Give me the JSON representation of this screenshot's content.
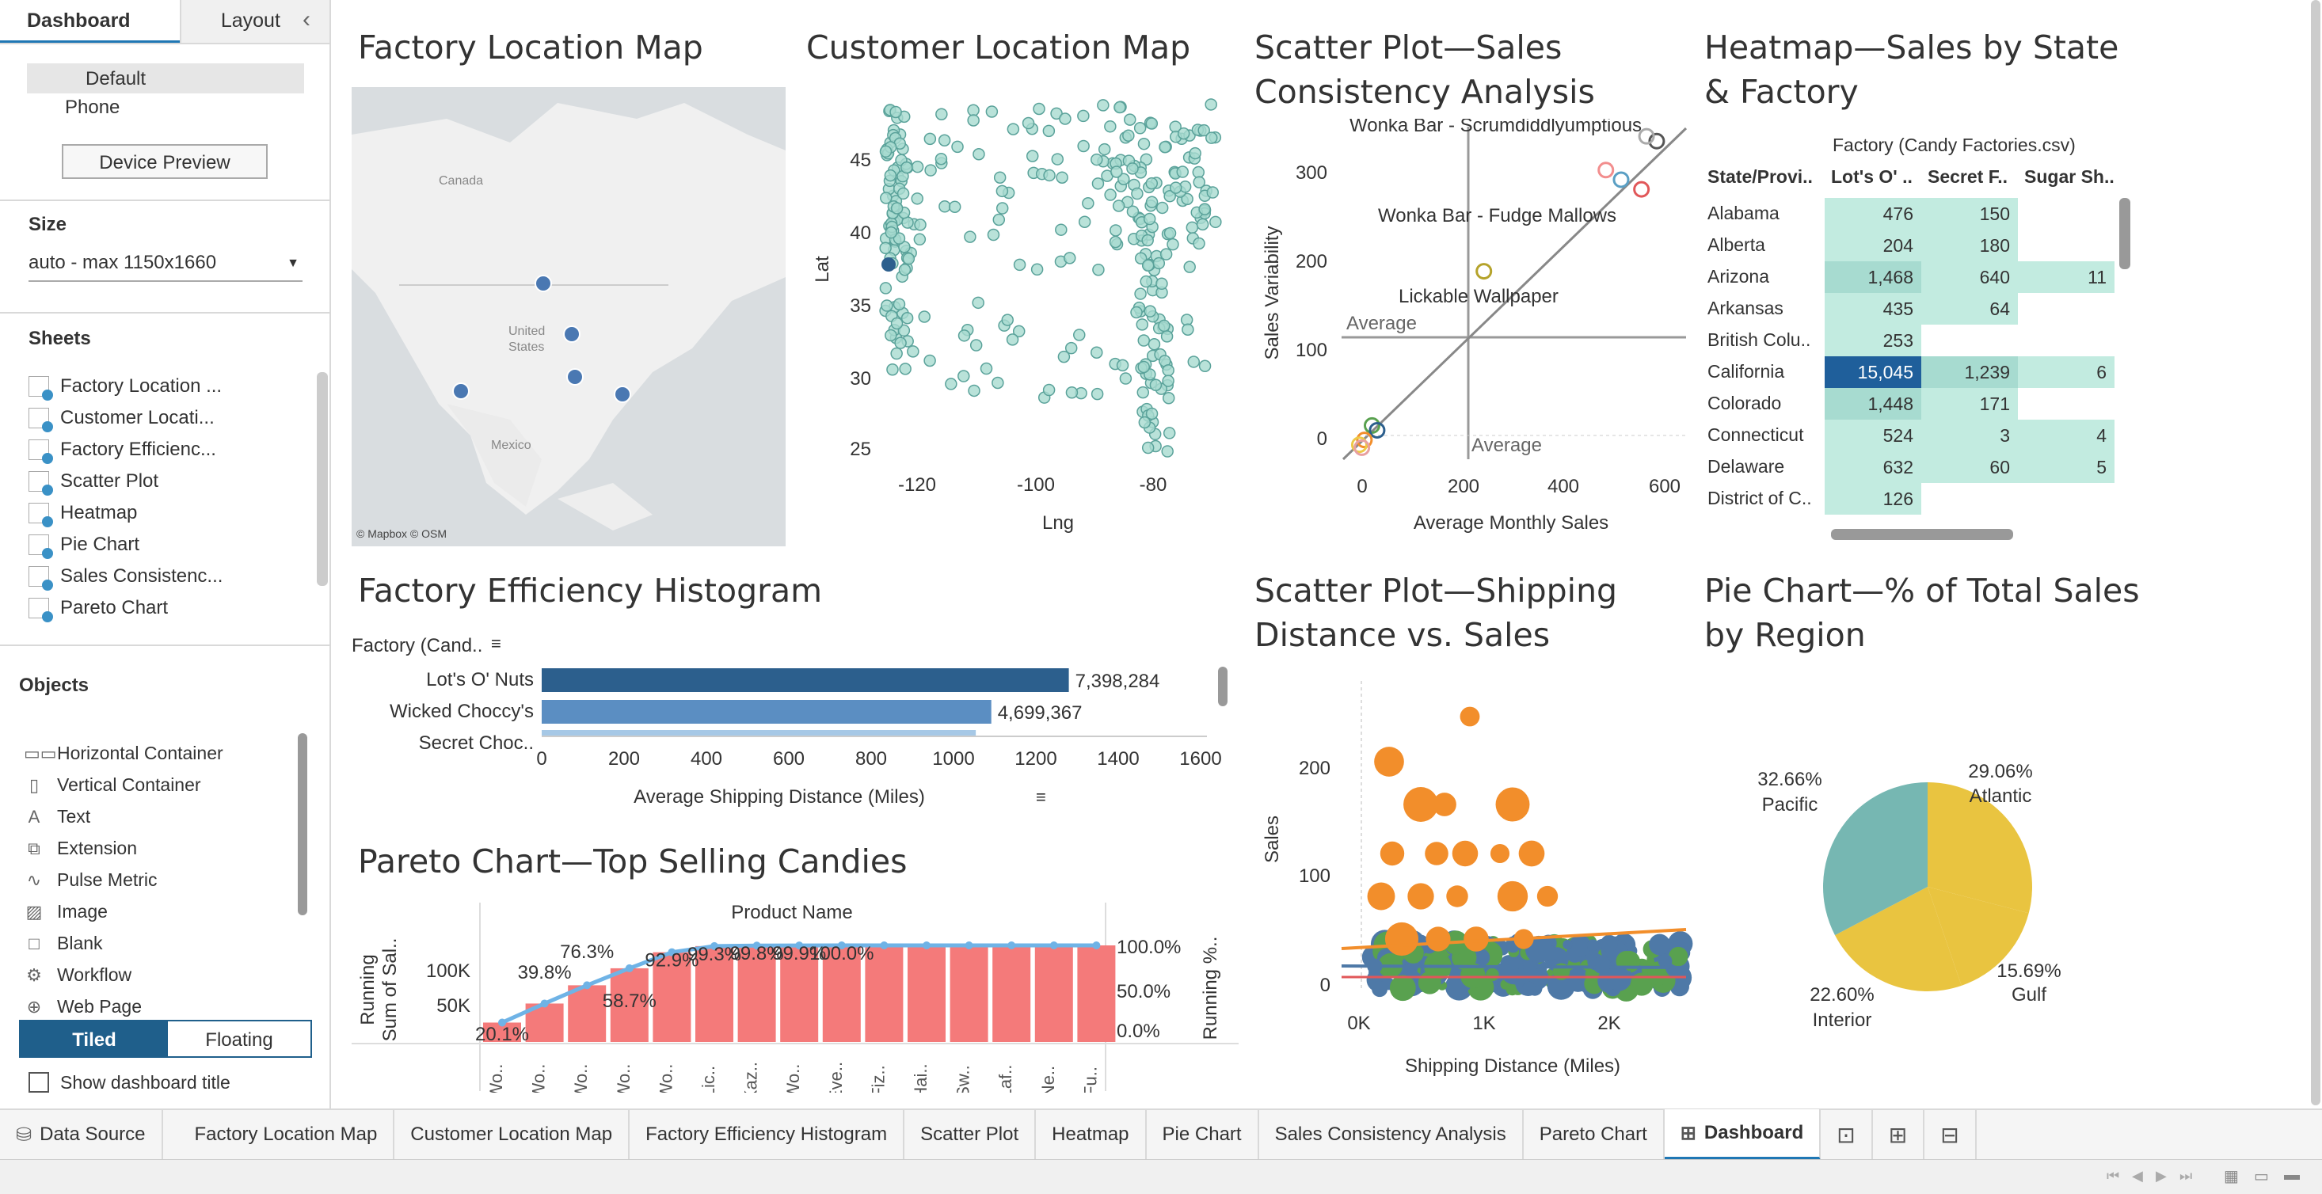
{
  "left_panel": {
    "tab_dashboard": "Dashboard",
    "tab_layout": "Layout",
    "device_default": "Default",
    "device_phone": "Phone",
    "device_preview": "Device Preview",
    "size_label": "Size",
    "size_value": "auto - max 1150x1660",
    "sheets_label": "Sheets",
    "sheets": [
      "Factory Location ...",
      "Customer Locati...",
      "Factory Efficienc...",
      "Scatter Plot",
      "Heatmap",
      "Pie Chart",
      "Sales Consistenc...",
      "Pareto Chart"
    ],
    "objects_label": "Objects",
    "objects": [
      {
        "icon": "horizontal-container-icon",
        "label": "Horizontal Container"
      },
      {
        "icon": "vertical-container-icon",
        "label": "Vertical Container"
      },
      {
        "icon": "text-icon",
        "label": "Text"
      },
      {
        "icon": "extension-icon",
        "label": "Extension"
      },
      {
        "icon": "pulse-metric-icon",
        "label": "Pulse Metric"
      },
      {
        "icon": "image-icon",
        "label": "Image"
      },
      {
        "icon": "blank-icon",
        "label": "Blank"
      },
      {
        "icon": "workflow-icon",
        "label": "Workflow"
      },
      {
        "icon": "web-page-icon",
        "label": "Web Page"
      }
    ],
    "tiled": "Tiled",
    "floating": "Floating",
    "show_title": "Show dashboard title"
  },
  "titles": {
    "factory_map": "Factory Location Map",
    "customer_map": "Customer Location Map",
    "scatter_sales_1": "Scatter Plot—Sales",
    "scatter_sales_2": "Consistency Analysis",
    "heatmap_1": "Heatmap—Sales by State",
    "heatmap_2": "& Factory",
    "histogram": "Factory Efficiency Histogram",
    "scatter_ship_1": "Scatter Plot—Shipping",
    "scatter_ship_2": "Distance vs. Sales",
    "pie_1": "Pie Chart—% of Total Sales",
    "pie_2": "by Region",
    "pareto_a": "Pareto Chart—",
    "pareto_b": "Top Selling Candies"
  },
  "factory_map": {
    "labels": [
      "Canada",
      "United",
      "States",
      "Mexico"
    ],
    "credit": "© Mapbox © OSM"
  },
  "customer_map": {
    "xlabel": "Lng",
    "ylabel": "Lat",
    "xticks": [
      "-120",
      "-100",
      "-80"
    ],
    "yticks": [
      "45",
      "40",
      "35",
      "30",
      "25"
    ]
  },
  "scatter_sales": {
    "xlabel": "Average Monthly Sales",
    "ylabel": "Sales Variability",
    "xticks": [
      "0",
      "200",
      "400",
      "600"
    ],
    "yticks": [
      "300",
      "200",
      "100",
      "0"
    ],
    "ref_h": "Average",
    "ref_v": "Average",
    "labels": [
      "Wonka Bar - Scrumdiddlyumptious",
      "Wonka Bar - Fudge Mallows",
      "Lickable Wallpaper"
    ]
  },
  "heatmap": {
    "col_header": "Factory (Candy Factories.csv)",
    "row_header": "State/Provi..",
    "columns": [
      "Lot's O' ..",
      "Secret F..",
      "Sugar Sh.."
    ],
    "rows": [
      {
        "state": "Alabama",
        "v": [
          "476",
          "150",
          ""
        ]
      },
      {
        "state": "Alberta",
        "v": [
          "204",
          "180",
          ""
        ]
      },
      {
        "state": "Arizona",
        "v": [
          "1,468",
          "640",
          "11"
        ]
      },
      {
        "state": "Arkansas",
        "v": [
          "435",
          "64",
          ""
        ]
      },
      {
        "state": "British Colu..",
        "v": [
          "253",
          "",
          ""
        ]
      },
      {
        "state": "California",
        "v": [
          "15,045",
          "1,239",
          "6"
        ]
      },
      {
        "state": "Colorado",
        "v": [
          "1,448",
          "171",
          ""
        ]
      },
      {
        "state": "Connecticut",
        "v": [
          "524",
          "3",
          "4"
        ]
      },
      {
        "state": "Delaware",
        "v": [
          "632",
          "60",
          "5"
        ]
      },
      {
        "state": "District of C..",
        "v": [
          "126",
          "",
          ""
        ]
      }
    ]
  },
  "histogram": {
    "header": "Factory (Cand..",
    "xlabel": "Average Shipping Distance (Miles)",
    "xticks": [
      "0",
      "200",
      "400",
      "600",
      "800",
      "1000",
      "1200",
      "1400",
      "1600"
    ],
    "bars": [
      {
        "label": "Lot's O' Nuts",
        "value": 1360,
        "text": "7,398,284"
      },
      {
        "label": "Wicked Choccy's",
        "value": 1160,
        "text": "4,699,367"
      },
      {
        "label": "Secret Choc..",
        "value": 1120,
        "text": ""
      }
    ]
  },
  "scatter_ship": {
    "xlabel": "Shipping Distance (Miles)",
    "ylabel": "Sales",
    "xticks": [
      "0K",
      "1K",
      "2K"
    ],
    "yticks": [
      "200",
      "100",
      "0"
    ]
  },
  "pie": {
    "slices": [
      {
        "name": "Atlantic",
        "pct": "29.06%"
      },
      {
        "name": "Gulf",
        "pct": "15.69%"
      },
      {
        "name": "Interior",
        "pct": "22.60%"
      },
      {
        "name": "Pacific",
        "pct": "32.66%"
      }
    ]
  },
  "pareto": {
    "header": "Product Name",
    "ylabel_left_1": "Running",
    "ylabel_left_2": "Sum of Sal..",
    "ylabel_right": "Running %..",
    "yticks_left": [
      "100K",
      "50K"
    ],
    "yticks_right": [
      "100.0%",
      "50.0%",
      "0.0%"
    ],
    "categories": [
      "Wo..",
      "Wo..",
      "Wo..",
      "Wo..",
      "Wo..",
      "Lic..",
      "Kaz..",
      "Wo..",
      "Eve..",
      "Fiz..",
      "Hai..",
      "Sw..",
      "Laf..",
      "Ne..",
      "Fu.."
    ],
    "labels": [
      "20.1%",
      "39.8%",
      "58.7%",
      "76.3%",
      "92.9%",
      "99.3%",
      "99.8%",
      "99.9%",
      "100.0%"
    ]
  },
  "bottom_tabs": [
    "Data Source",
    "Factory Location Map",
    "Customer Location Map",
    "Factory Efficiency Histogram",
    "Scatter Plot",
    "Heatmap",
    "Pie Chart",
    "Sales Consistency Analysis",
    "Pareto Chart",
    "Dashboard"
  ],
  "chart_data": [
    {
      "type": "bar",
      "title": "Factory Efficiency Histogram",
      "xlabel": "Average Shipping Distance (Miles)",
      "categories": [
        "Lot's O' Nuts",
        "Wicked Choccy's"
      ],
      "values": [
        1360,
        1160
      ],
      "data_labels": [
        "7,398,284",
        "4,699,367"
      ],
      "xlim": [
        0,
        1700
      ]
    },
    {
      "type": "pie",
      "title": "Pie Chart—% of Total Sales by Region",
      "categories": [
        "Atlantic",
        "Gulf",
        "Interior",
        "Pacific"
      ],
      "values": [
        29.06,
        15.69,
        22.6,
        32.66
      ]
    },
    {
      "type": "bar",
      "title": "Pareto Chart—Top Selling Candies",
      "xlabel": "Product Name",
      "categories": [
        "Wo..",
        "Wo..",
        "Wo..",
        "Wo..",
        "Wo..",
        "Lic..",
        "Kaz..",
        "Wo..",
        "Eve..",
        "Fiz..",
        "Hai..",
        "Sw..",
        "Laf..",
        "Ne..",
        "Fu.."
      ],
      "running_pct": [
        20.1,
        39.8,
        58.7,
        76.3,
        92.9,
        99.3,
        99.8,
        99.9,
        100.0,
        100.0,
        100.0,
        100.0,
        100.0,
        100.0,
        100.0
      ]
    },
    {
      "type": "scatter",
      "title": "Scatter Plot—Sales Consistency Analysis",
      "xlabel": "Average Monthly Sales",
      "ylabel": "Sales Variability",
      "xlim": [
        -30,
        640
      ],
      "ylim": [
        -15,
        330
      ],
      "points": [
        [
          590,
          315
        ],
        [
          570,
          320
        ],
        [
          520,
          275
        ],
        [
          490,
          285
        ],
        [
          560,
          265
        ],
        [
          250,
          180
        ],
        [
          30,
          20
        ],
        [
          40,
          15
        ],
        [
          15,
          5
        ],
        [
          5,
          0
        ],
        [
          10,
          -3
        ]
      ]
    }
  ]
}
